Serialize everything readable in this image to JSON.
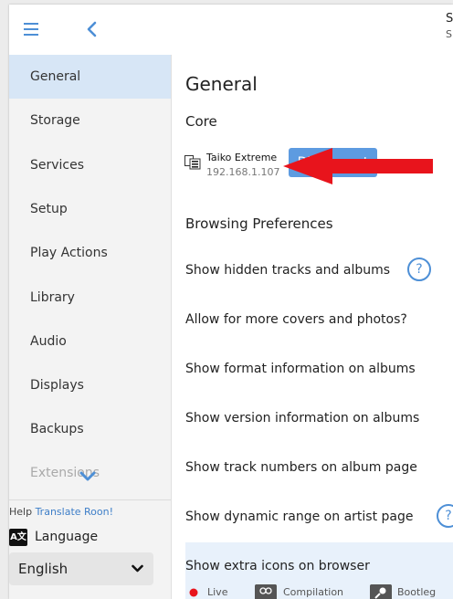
{
  "topbar": {
    "right_line_1": "S",
    "right_line_2": "S"
  },
  "sidebar": {
    "items": [
      {
        "label": "General",
        "active": true
      },
      {
        "label": "Storage"
      },
      {
        "label": "Services"
      },
      {
        "label": "Setup"
      },
      {
        "label": "Play Actions"
      },
      {
        "label": "Library"
      },
      {
        "label": "Audio"
      },
      {
        "label": "Displays"
      },
      {
        "label": "Backups"
      },
      {
        "label": "Extensions"
      }
    ],
    "help_prefix": "Help",
    "help_link": "Translate Roon!",
    "language_icon": "A文",
    "language_label": "Language",
    "language_value": "English"
  },
  "main": {
    "title": "General",
    "core_heading": "Core",
    "core_name": "Taiko Extreme",
    "core_ip": "192.168.1.107",
    "disconnect_label": "Disconnect",
    "browsing_heading": "Browsing Preferences",
    "prefs": [
      "Show hidden tracks and albums",
      "Allow for more covers and photos?",
      "Show format information on albums",
      "Show version information on albums",
      "Show track numbers on album page",
      "Show dynamic range on artist page"
    ],
    "help_glyph": "?",
    "extra_icons_label": "Show extra icons on browser",
    "chips": [
      "Live",
      "Compilation",
      "Bootleg"
    ]
  },
  "colors": {
    "accent": "#5d9be0",
    "active_nav": "#d7e6f6",
    "annotation": "#e8141c"
  }
}
